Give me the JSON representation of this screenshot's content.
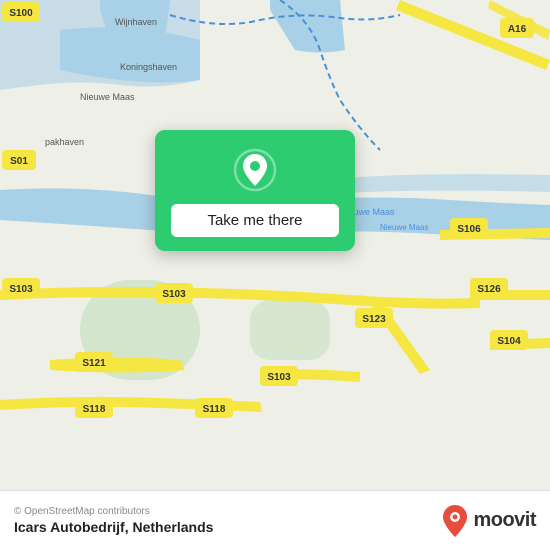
{
  "map": {
    "alt": "OpenStreetMap of Rotterdam area, Netherlands"
  },
  "popup": {
    "button_label": "Take me there"
  },
  "footer": {
    "copyright": "© OpenStreetMap contributors",
    "title": "Icars Autobedrijf, Netherlands"
  },
  "moovit": {
    "text": "moovit"
  },
  "colors": {
    "green": "#2ecc71",
    "road_yellow": "#f5e642",
    "water_blue": "#a8d0e6",
    "land_light": "#f0ece0",
    "land_green": "#d8ead8"
  }
}
